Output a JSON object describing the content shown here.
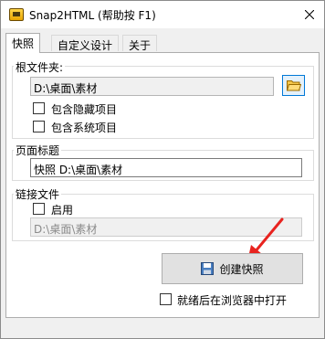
{
  "window": {
    "title": "Snap2HTML (帮助按 F1)"
  },
  "tabs": [
    {
      "label": "快照",
      "active": true
    },
    {
      "label": "自定义设计",
      "active": false
    },
    {
      "label": "关于",
      "active": false
    }
  ],
  "root_folder": {
    "label": "根文件夹:",
    "path": "D:\\桌面\\素材",
    "include_hidden": {
      "label": "包含隐藏项目",
      "checked": false
    },
    "include_system": {
      "label": "包含系统项目",
      "checked": false
    }
  },
  "page_title": {
    "label": "页面标题",
    "value": "快照 D:\\桌面\\素材"
  },
  "link_files": {
    "label": "链接文件",
    "enable": {
      "label": "启用",
      "checked": false
    },
    "path": "D:\\桌面\\素材"
  },
  "create_button": {
    "label": "创建快照"
  },
  "open_when_done": {
    "label": "就绪后在浏览器中打开",
    "checked": false
  },
  "colors": {
    "accent": "#0078d7",
    "arrow": "#e8231f"
  }
}
